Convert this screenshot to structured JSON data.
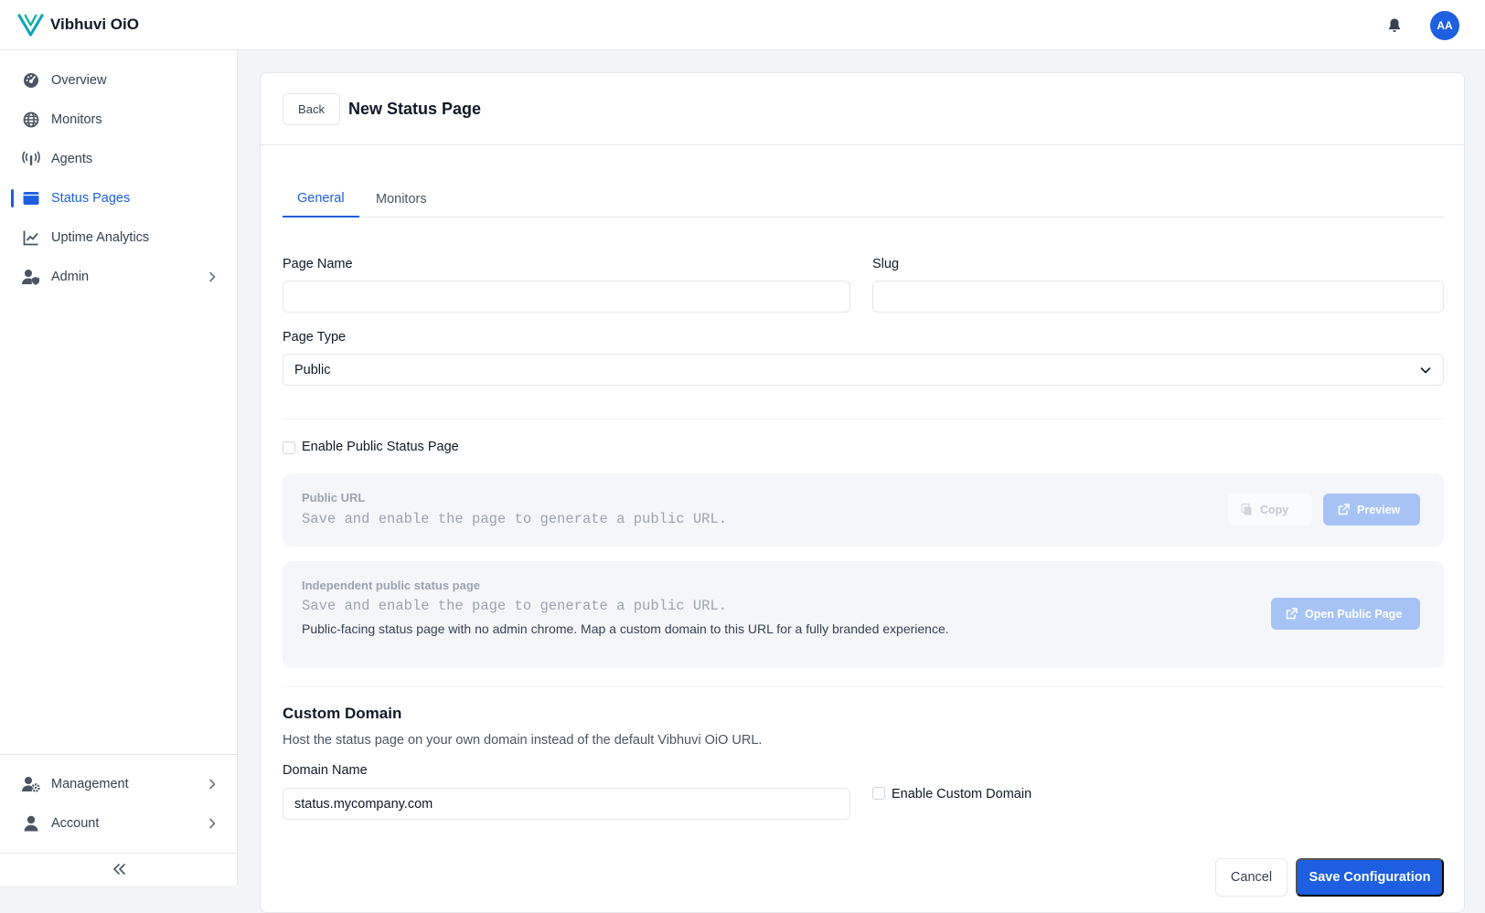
{
  "app": {
    "name": "Vibhuvi OiO",
    "user_initials": "AA"
  },
  "icons": {
    "logo": "v-logo-icon",
    "bell": "bell-icon"
  },
  "sidebar": {
    "items": [
      {
        "label": "Overview",
        "icon": "gauge-icon"
      },
      {
        "label": "Monitors",
        "icon": "globe-icon"
      },
      {
        "label": "Agents",
        "icon": "antenna-icon"
      },
      {
        "label": "Status Pages",
        "icon": "browser-window-icon",
        "active": true
      },
      {
        "label": "Uptime Analytics",
        "icon": "chart-line-icon"
      },
      {
        "label": "Admin",
        "icon": "user-shield-icon",
        "expandable": true
      }
    ],
    "bottom_items": [
      {
        "label": "Management",
        "icon": "user-gear-icon",
        "expandable": true
      },
      {
        "label": "Account",
        "icon": "user-icon",
        "expandable": true
      }
    ]
  },
  "page": {
    "back_label": "Back",
    "title": "New Status Page",
    "tabs": [
      {
        "label": "General",
        "active": true
      },
      {
        "label": "Monitors",
        "active": false
      }
    ]
  },
  "form": {
    "page_name": {
      "label": "Page Name",
      "value": ""
    },
    "slug": {
      "label": "Slug",
      "value": ""
    },
    "page_type": {
      "label": "Page Type",
      "value": "Public"
    },
    "enable_public": {
      "label": "Enable Public Status Page",
      "checked": false
    },
    "public_url": {
      "title": "Public URL",
      "value": "Save and enable the page to generate a public URL.",
      "copy_label": "Copy",
      "preview_label": "Preview"
    },
    "independent": {
      "title": "Independent public status page",
      "value": "Save and enable the page to generate a public URL.",
      "description": "Public-facing status page with no admin chrome. Map a custom domain to this URL for a fully branded experience.",
      "open_label": "Open Public Page"
    },
    "custom_domain": {
      "title": "Custom Domain",
      "description": "Host the status page on your own domain instead of the default Vibhuvi OiO URL.",
      "domain_label": "Domain Name",
      "domain_placeholder": "status.mycompany.com",
      "enable_label": "Enable Custom Domain",
      "enabled": false
    },
    "actions": {
      "cancel_label": "Cancel",
      "save_label": "Save Configuration"
    }
  },
  "colors": {
    "primary": "#1d5fe0",
    "primary_faded": "#a7c3f5",
    "panel_bg": "#f5f6fa",
    "page_bg": "#f3f4f6"
  }
}
